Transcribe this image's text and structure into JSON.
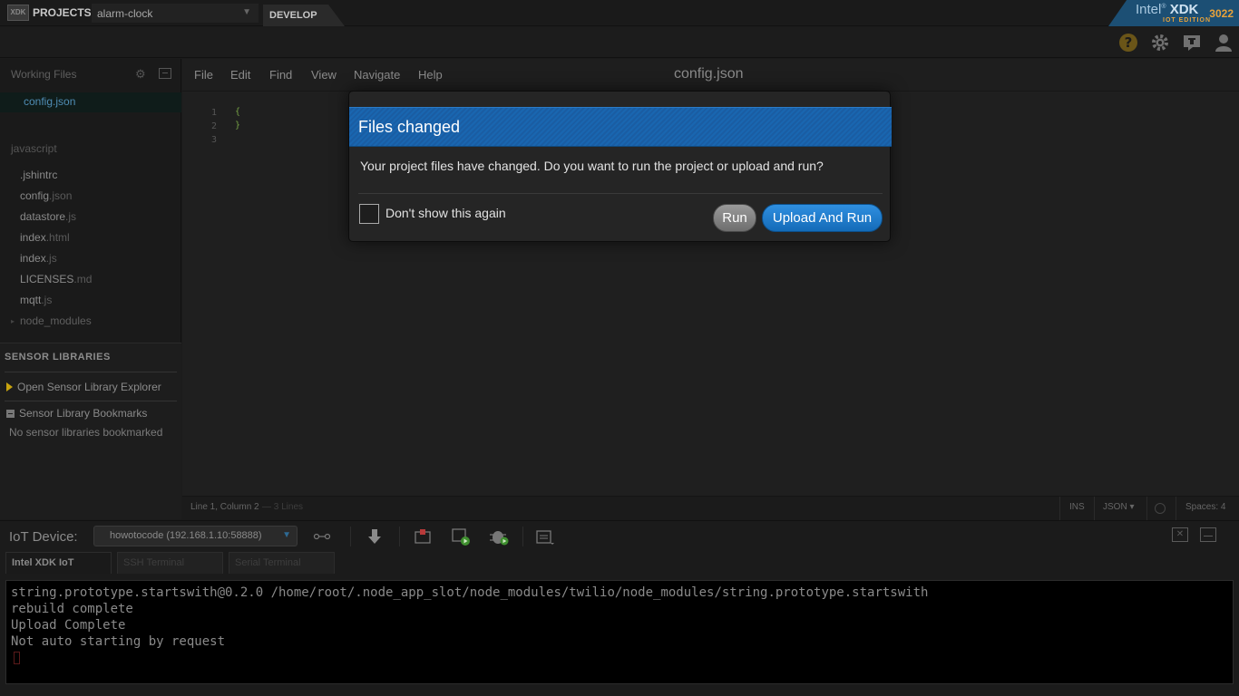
{
  "topbar": {
    "logo": "XDK",
    "projects_label": "PROJECTS",
    "project_name": "alarm-clock",
    "develop_tab": "DEVELOP",
    "brand": {
      "intel": "Intel",
      "xdk": "XDK",
      "number": "3022",
      "edition": "IOT EDITION"
    }
  },
  "iconbar": {
    "icons": [
      "help-icon",
      "settings-icon",
      "feedback-icon",
      "user-icon"
    ],
    "help_glyph": "?"
  },
  "sidebar": {
    "working_files_title": "Working Files",
    "working_file": "config.json",
    "folder_title": "javascript",
    "files": [
      {
        "name": ".jshintrc",
        "ext": ""
      },
      {
        "name": "config",
        "ext": ".json"
      },
      {
        "name": "datastore",
        "ext": ".js"
      },
      {
        "name": "index",
        "ext": ".html"
      },
      {
        "name": "index",
        "ext": ".js"
      },
      {
        "name": "LICENSES",
        "ext": ".md"
      },
      {
        "name": "mqtt",
        "ext": ".js"
      },
      {
        "name": "node_modules",
        "ext": ""
      }
    ],
    "sensor_libraries": {
      "title": "SENSOR LIBRARIES",
      "open_explorer": "Open Sensor Library Explorer",
      "bookmarks": "Sensor Library Bookmarks",
      "empty_text": "No sensor libraries bookmarked"
    }
  },
  "editor": {
    "menu": [
      "File",
      "Edit",
      "Find",
      "View",
      "Navigate",
      "Help"
    ],
    "filename": "config.json",
    "lines": [
      {
        "num": "1",
        "code": "{"
      },
      {
        "num": "2",
        "code": "}"
      },
      {
        "num": "3",
        "code": ""
      }
    ],
    "status": {
      "cursor": "Line 1, Column 2",
      "line_count": "— 3 Lines",
      "ins": "INS",
      "language": "JSON ▾",
      "spaces": "Spaces: 4"
    }
  },
  "iot": {
    "device_label": "IoT Device:",
    "device_value": "howotocode (192.168.1.10:58888)",
    "tabs": [
      "Intel XDK IoT",
      "SSH Terminal",
      "Serial Terminal"
    ],
    "terminal_lines": [
      "string.prototype.startswith@0.2.0 /home/root/.node_app_slot/node_modules/twilio/node_modules/string.prototype.startswith",
      "rebuild complete",
      "Upload Complete",
      "Not auto starting by request"
    ]
  },
  "dialog": {
    "title": "Files changed",
    "message": "Your project files have changed. Do you want to run the project or upload and run?",
    "checkbox_label": "Don't show this again",
    "run_button": "Run",
    "upload_run_button": "Upload And Run"
  },
  "colors": {
    "accent_blue": "#1966b0",
    "brand_orange": "#e8a23a",
    "code_green": "#75a045",
    "link_blue": "#4f8db5"
  }
}
